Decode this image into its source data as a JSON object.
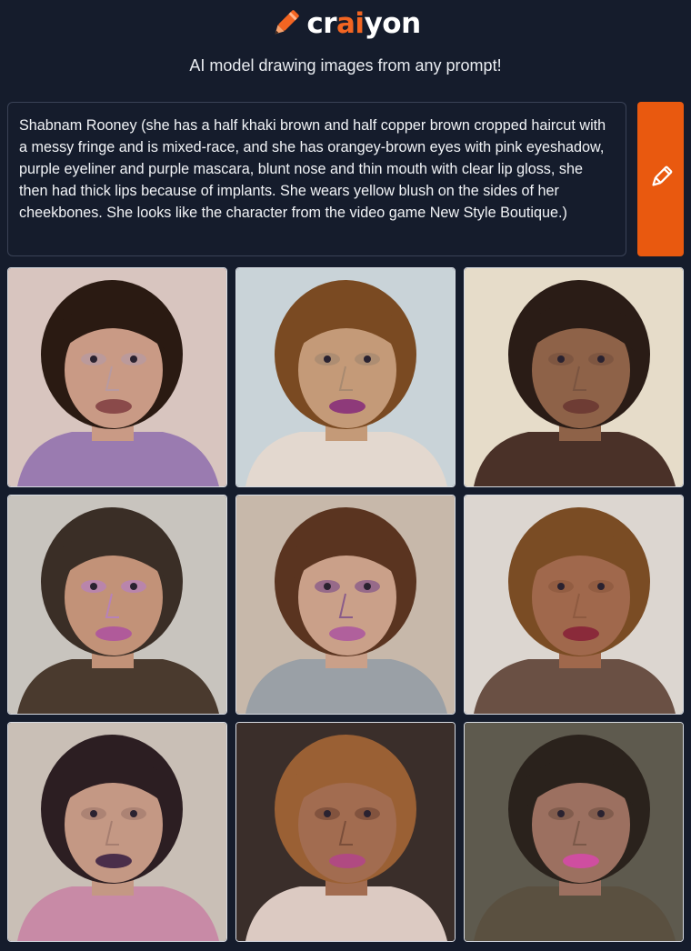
{
  "header": {
    "logo_prefix": "cr",
    "logo_accent": "ai",
    "logo_suffix": "yon",
    "icon": "pencil-icon",
    "accent_color": "#f26522"
  },
  "tagline": "AI model drawing images from any prompt!",
  "prompt": {
    "value": "Shabnam Rooney (she has a half khaki brown and half copper brown cropped haircut with a messy fringe and is mixed-race, and she has orangey-brown eyes with pink eyeshadow, purple eyeliner and purple mascara, blunt nose and thin mouth with clear lip gloss, she then had thick lips because of implants. She wears yellow blush on the sides of her cheekbones. She looks like the character from the video game New Style Boutique.)"
  },
  "draw_button": {
    "icon": "pencil-icon",
    "color": "#e9590f"
  },
  "results": [
    {
      "bg": "#d8c5bf",
      "hair": "#2a1a12",
      "skin": "#c99a85",
      "lips": "#8a4a4a",
      "cloth": "#9a7bb0",
      "shade": "#b89aa0"
    },
    {
      "bg": "#c9d3d8",
      "hair": "#7a4a22",
      "skin": "#c49a78",
      "lips": "#8e3a7a",
      "cloth": "#e3d8cf",
      "shade": "#a88a70"
    },
    {
      "bg": "#e6dcc9",
      "hair": "#2a1c16",
      "skin": "#8e6248",
      "lips": "#6e3c34",
      "cloth": "#4a3128",
      "shade": "#7a5440"
    },
    {
      "bg": "#c8c4be",
      "hair": "#3a2e26",
      "skin": "#c29278",
      "lips": "#b05a9a",
      "cloth": "#4a3a2e",
      "shade": "#b782b8"
    },
    {
      "bg": "#c7b8aa",
      "hair": "#5a3420",
      "skin": "#caa089",
      "lips": "#b0609c",
      "cloth": "#9aa0a6",
      "shade": "#8a5c8a"
    },
    {
      "bg": "#dcd6d0",
      "hair": "#7a4c24",
      "skin": "#a0684c",
      "lips": "#8a2a3a",
      "cloth": "#6a5044",
      "shade": "#8e5a40"
    },
    {
      "bg": "#c9bfb6",
      "hair": "#2c1e22",
      "skin": "#c49884",
      "lips": "#4a2e4a",
      "cloth": "#c88aa6",
      "shade": "#a67e70"
    },
    {
      "bg": "#3a2e2a",
      "hair": "#9a6034",
      "skin": "#a26c50",
      "lips": "#b04a82",
      "cloth": "#dccac2",
      "shade": "#7a4e3a"
    },
    {
      "bg": "#5e5a4e",
      "hair": "#2a221c",
      "skin": "#9c7060",
      "lips": "#cf4ea0",
      "cloth": "#5a5040",
      "shade": "#7a5848"
    }
  ]
}
